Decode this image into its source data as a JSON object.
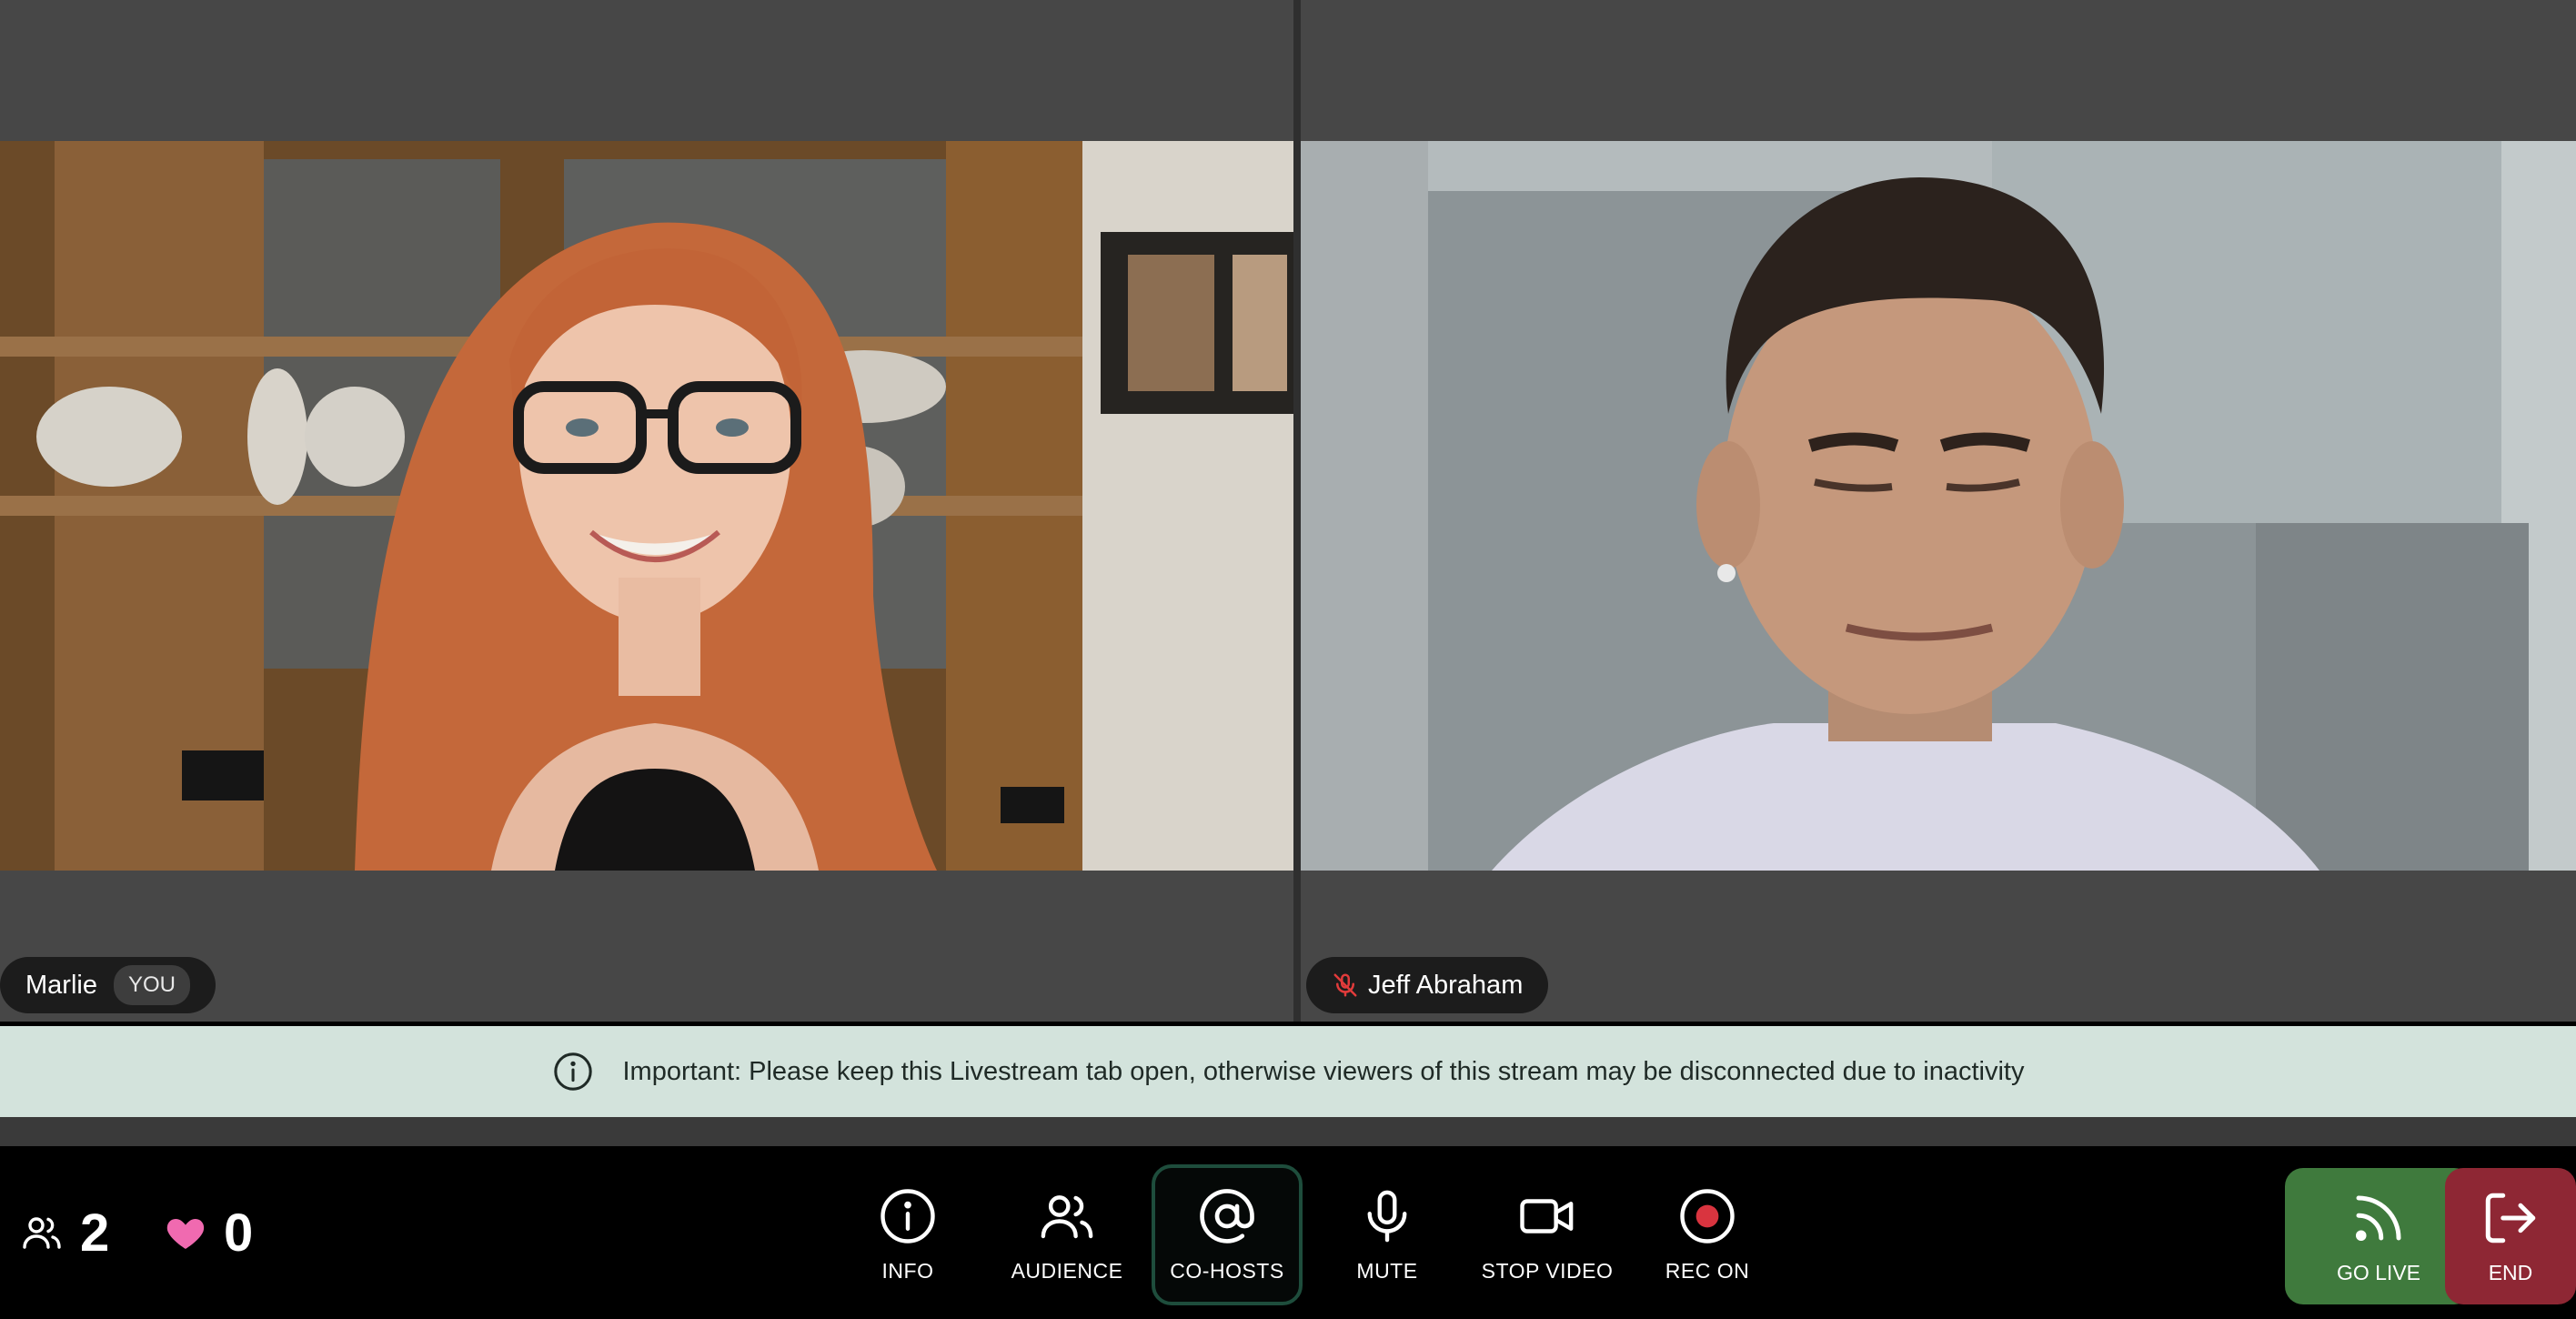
{
  "participants": [
    {
      "name": "Marlie",
      "badge": "YOU",
      "muted": false
    },
    {
      "name": "Jeff Abraham",
      "muted": true
    }
  ],
  "notice": {
    "text": "Important: Please keep this Livestream tab open, otherwise viewers of this stream may be disconnected due to inactivity"
  },
  "stats": {
    "viewers": "2",
    "likes": "0"
  },
  "controls": {
    "info": "INFO",
    "audience": "AUDIENCE",
    "cohosts": "CO-HOSTS",
    "mute": "MUTE",
    "stop_video": "STOP VIDEO",
    "rec_on": "REC ON",
    "go_live": "GO LIVE",
    "end": "END"
  },
  "colors": {
    "notice_bg": "#d3e3dc",
    "go_live": "#3f7a3d",
    "end": "#8e2734",
    "heart": "#f06ab0",
    "rec_dot": "#d9343f"
  }
}
